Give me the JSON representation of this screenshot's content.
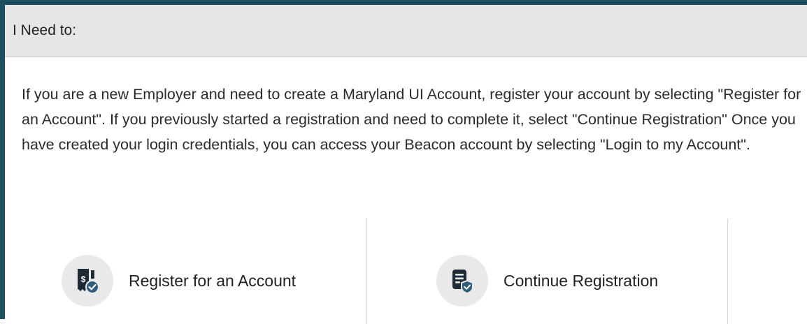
{
  "header": {
    "title": "I Need to:"
  },
  "intro": {
    "text": "If you are a new Employer and need to create a Maryland UI Account, register your account by selecting \"Register for an Account\". If you previously started a registration and need to complete it, select \"Continue Registration\" Once you have created your login credentials, you can access your Beacon account by selecting \"Login to my Account\"."
  },
  "options": [
    {
      "label": "Register for an Account",
      "icon": "receipt-dollar-check-icon"
    },
    {
      "label": "Continue Registration",
      "icon": "document-shield-check-icon"
    }
  ],
  "colors": {
    "accent_border": "#1f4f5e",
    "header_bg": "#e6e6e6",
    "icon_circle_bg": "#e9e9e9",
    "icon_dark": "#1e2b36",
    "icon_badge": "#2f5d7c"
  }
}
